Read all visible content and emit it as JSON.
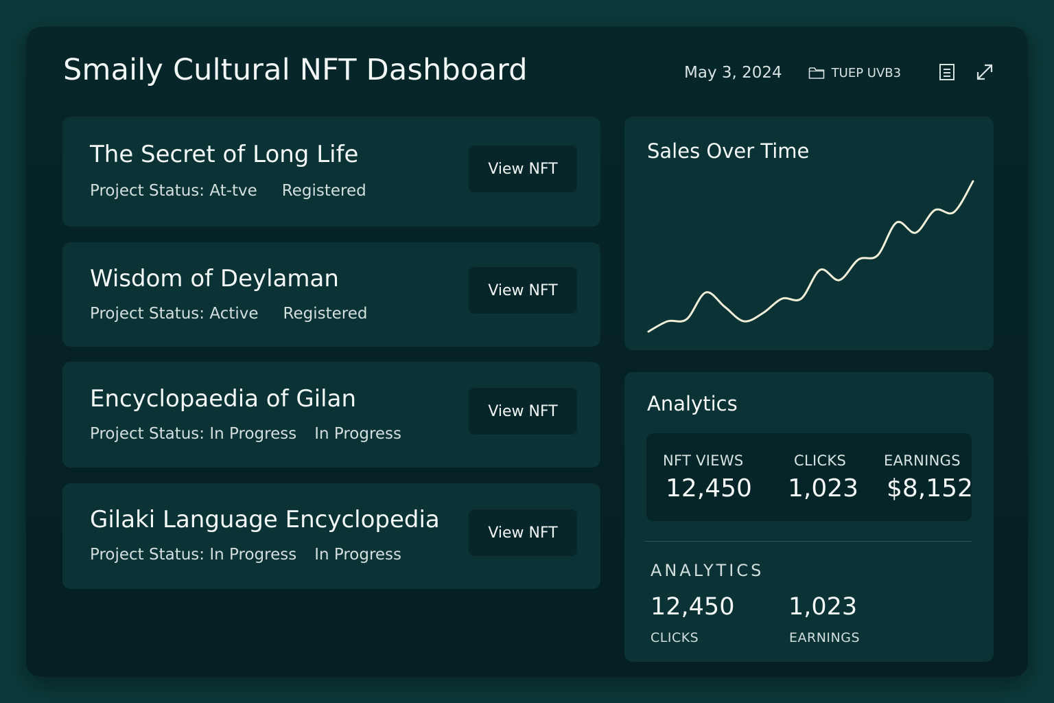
{
  "header": {
    "title": "Smaily Cultural NFT Dashboard",
    "date": "May 3, 2024",
    "folder_label": "TUEP UVB3",
    "icons": [
      "folder-icon",
      "document-icon",
      "expand-icon"
    ]
  },
  "projects": [
    {
      "title": "The Secret of Long Life",
      "status_label": "Project Status:",
      "status_value": "At-tve",
      "tag": "Registered",
      "button_label": "View NFT"
    },
    {
      "title": "Wisdom of Deylaman",
      "status_label": "Project Status:",
      "status_value": "Active",
      "tag": "Registered",
      "button_label": "View NFT"
    },
    {
      "title": "Encyclopaedia of Gilan",
      "status_label": "Project Status:",
      "status_value": "In Progress",
      "tag": "In Progress",
      "button_label": "View NFT"
    },
    {
      "title": "Gilaki Language Encyclopedia",
      "status_label": "Project Status:",
      "status_value": "In Progress",
      "tag": "In Progress",
      "button_label": "View NFT"
    }
  ],
  "sales_panel": {
    "title": "Sales Over Time"
  },
  "chart_data": {
    "type": "line",
    "title": "Sales Over Time",
    "xlabel": "",
    "ylabel": "",
    "grid": false,
    "axes_visible": false,
    "series": [
      {
        "values": [
          4,
          9,
          10,
          23,
          16,
          9,
          13,
          20,
          20,
          34,
          29,
          39,
          41,
          57,
          52,
          63,
          62,
          77
        ]
      }
    ],
    "ylim": [
      0,
      80
    ],
    "color": "#f1efd8"
  },
  "analytics": {
    "title": "Analytics",
    "stats": [
      {
        "label": "NFT VIEWS",
        "value": "12,450"
      },
      {
        "label": "CLICKS",
        "value": "1,023"
      },
      {
        "label": "EARNINGS",
        "value": "$8,152"
      }
    ],
    "secondary_heading": "ANALYTICS",
    "secondary": [
      {
        "value": "12,450",
        "label": "CLICKS"
      },
      {
        "value": "1,023",
        "label": "EARNINGS"
      }
    ]
  },
  "colors": {
    "background": "#0c3a3b",
    "frame": "#06262a",
    "card": "#0b3336",
    "button": "#06262a",
    "text": "#f4f8f7",
    "line": "#f1efd8"
  }
}
